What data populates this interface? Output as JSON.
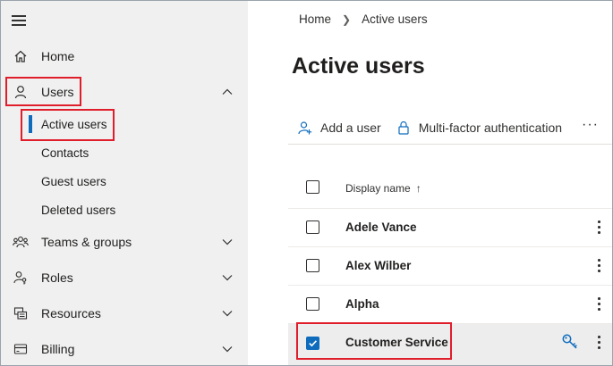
{
  "sidebar": {
    "home": {
      "label": "Home",
      "icon": "home-icon"
    },
    "users": {
      "label": "Users",
      "icon": "person-icon",
      "expanded": true
    },
    "users_subitems": [
      {
        "label": "Active users",
        "active": true
      },
      {
        "label": "Contacts"
      },
      {
        "label": "Guest users"
      },
      {
        "label": "Deleted users"
      }
    ],
    "teams_groups": {
      "label": "Teams & groups",
      "icon": "people-group-icon"
    },
    "roles": {
      "label": "Roles",
      "icon": "person-key-icon"
    },
    "resources": {
      "label": "Resources",
      "icon": "resources-icon"
    },
    "billing": {
      "label": "Billing",
      "icon": "credit-card-icon"
    }
  },
  "breadcrumb": {
    "home": "Home",
    "current": "Active users"
  },
  "page": {
    "title": "Active users"
  },
  "commands": {
    "add_user": "Add a user",
    "mfa": "Multi-factor authentication",
    "more": "···"
  },
  "table": {
    "column_header": "Display name",
    "sort_indicator": "↑",
    "rows": [
      {
        "name": "Adele Vance",
        "checked": false
      },
      {
        "name": "Alex Wilber",
        "checked": false
      },
      {
        "name": "Alpha",
        "checked": false
      },
      {
        "name": "Customer Service",
        "checked": true
      }
    ]
  },
  "colors": {
    "accent": "#0f6cbd",
    "highlight": "#e01e2b",
    "sidebar_bg": "#f0f0f0"
  }
}
